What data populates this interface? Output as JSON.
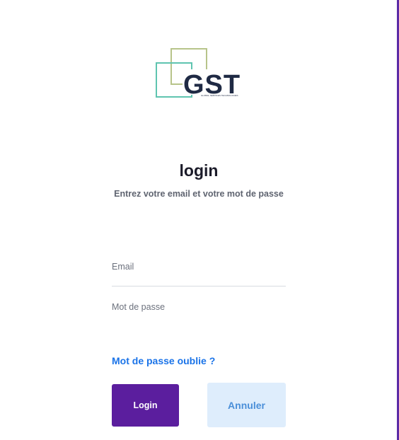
{
  "logo": {
    "text": "GST",
    "tagline": "GLOBAL SERVICES TECHNOLOGIES",
    "colors": {
      "text": "#1f2a44",
      "square_olive": "#b7c48a",
      "square_teal": "#5fc4b0"
    }
  },
  "login": {
    "title": "login",
    "subtitle": "Entrez votre email et votre mot de passe"
  },
  "form": {
    "email": {
      "placeholder": "Email",
      "value": ""
    },
    "password": {
      "placeholder": "Mot de passe",
      "value": ""
    },
    "forgot_label": "Mot de passe oublie ?"
  },
  "buttons": {
    "login_label": "Login",
    "cancel_label": "Annuler"
  },
  "colors": {
    "primary": "#5b1e9e",
    "link": "#1a73e8",
    "cancel_bg": "#deedfc",
    "cancel_text": "#4a8fd9",
    "frame_border": "#5b2ba6"
  }
}
